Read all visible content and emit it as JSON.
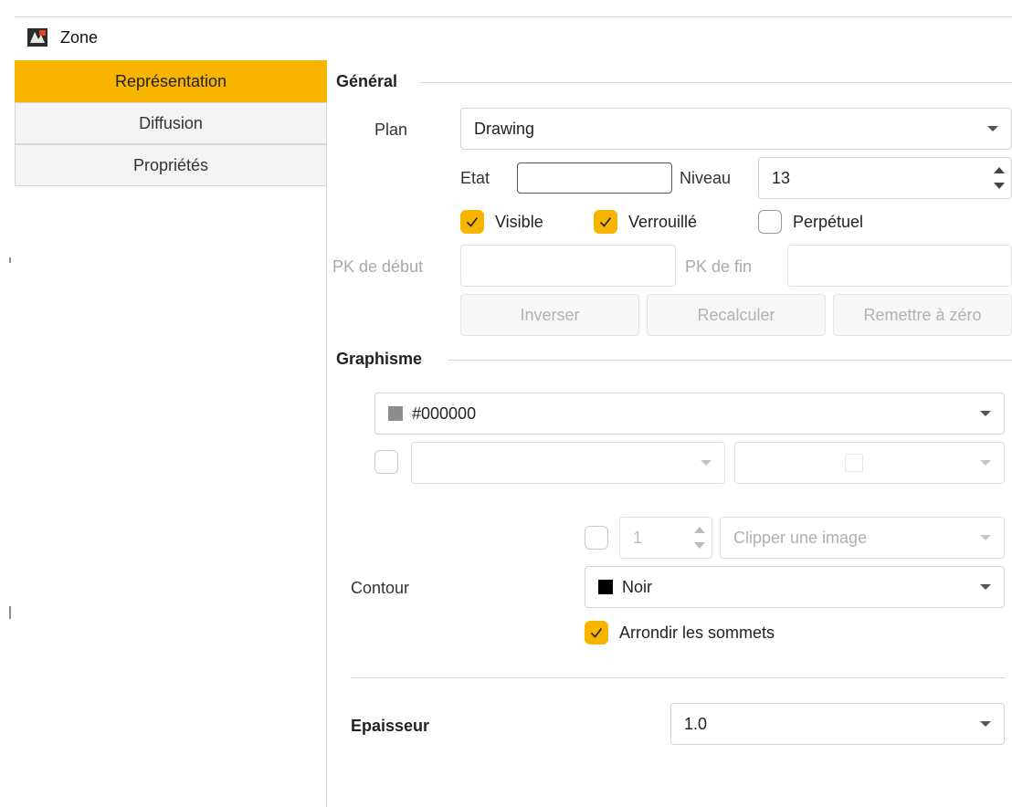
{
  "window": {
    "title": "Zone",
    "app_icon": "zone-app-icon"
  },
  "sidebar": {
    "items": [
      {
        "label": "Représentation",
        "active": true
      },
      {
        "label": "Diffusion",
        "active": false
      },
      {
        "label": "Propriétés",
        "active": false
      }
    ]
  },
  "general": {
    "header": "Général",
    "plan_label": "Plan",
    "plan_value": "Drawing",
    "etat_label": "Etat",
    "etat_value": "",
    "niveau_label": "Niveau",
    "niveau_value": "13",
    "visible_label": "Visible",
    "visible_checked": true,
    "verrouille_label": "Verrouillé",
    "verrouille_checked": true,
    "perpetuel_label": "Perpétuel",
    "perpetuel_checked": false,
    "pk_debut_label": "PK de début",
    "pk_debut_value": "",
    "pk_fin_label": "PK de fin",
    "pk_fin_value": "",
    "inverser_label": "Inverser",
    "recalculer_label": "Recalculer",
    "remettre_label": "Remettre à zéro"
  },
  "graphisme": {
    "header": "Graphisme",
    "color_value": "#000000",
    "color_swatch": "#8c8c8c",
    "pattern_checked": false,
    "pattern_value": "",
    "pattern2_value": "",
    "clip_checked": false,
    "clip_count": "1",
    "clip_placeholder": "Clipper une image",
    "contour_label": "Contour",
    "contour_value": "Noir",
    "contour_swatch": "#000000",
    "arrondir_label": "Arrondir les sommets",
    "arrondir_checked": true,
    "epaisseur_label": "Epaisseur",
    "epaisseur_value": "1.0"
  },
  "colors": {
    "accent": "#f7b500",
    "nav_bg": "#f2f3f5"
  }
}
